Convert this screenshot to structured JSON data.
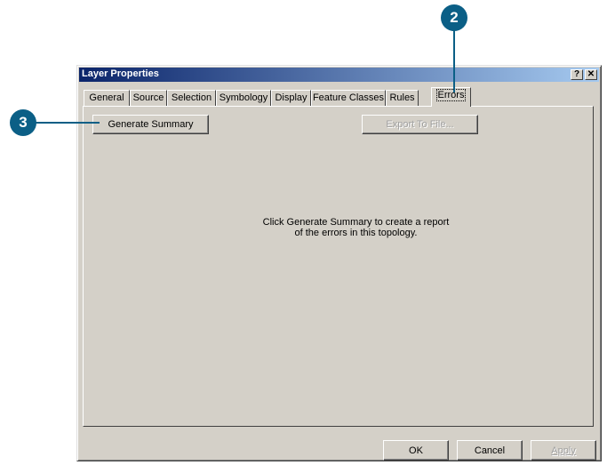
{
  "window": {
    "title": "Layer Properties",
    "help_label": "?",
    "close_label": "✕"
  },
  "tabs": [
    {
      "label": "General"
    },
    {
      "label": "Source"
    },
    {
      "label": "Selection"
    },
    {
      "label": "Symbology"
    },
    {
      "label": "Display"
    },
    {
      "label": "Feature Classes"
    },
    {
      "label": "Rules"
    },
    {
      "label": "Errors"
    }
  ],
  "errors_panel": {
    "generate_summary_label": "Generate Summary",
    "export_label": "Export To File...",
    "message_line1": "Click Generate Summary to create a report",
    "message_line2": "of the errors in this topology."
  },
  "footer": {
    "ok_label": "OK",
    "cancel_label": "Cancel",
    "apply_label": "Apply"
  },
  "callouts": {
    "step2": "2",
    "step3": "3"
  },
  "colors": {
    "callout": "#0b5f86",
    "titlebar_start": "#0a246a",
    "titlebar_end": "#a6caf0",
    "dialog_face": "#d4d0c8"
  }
}
